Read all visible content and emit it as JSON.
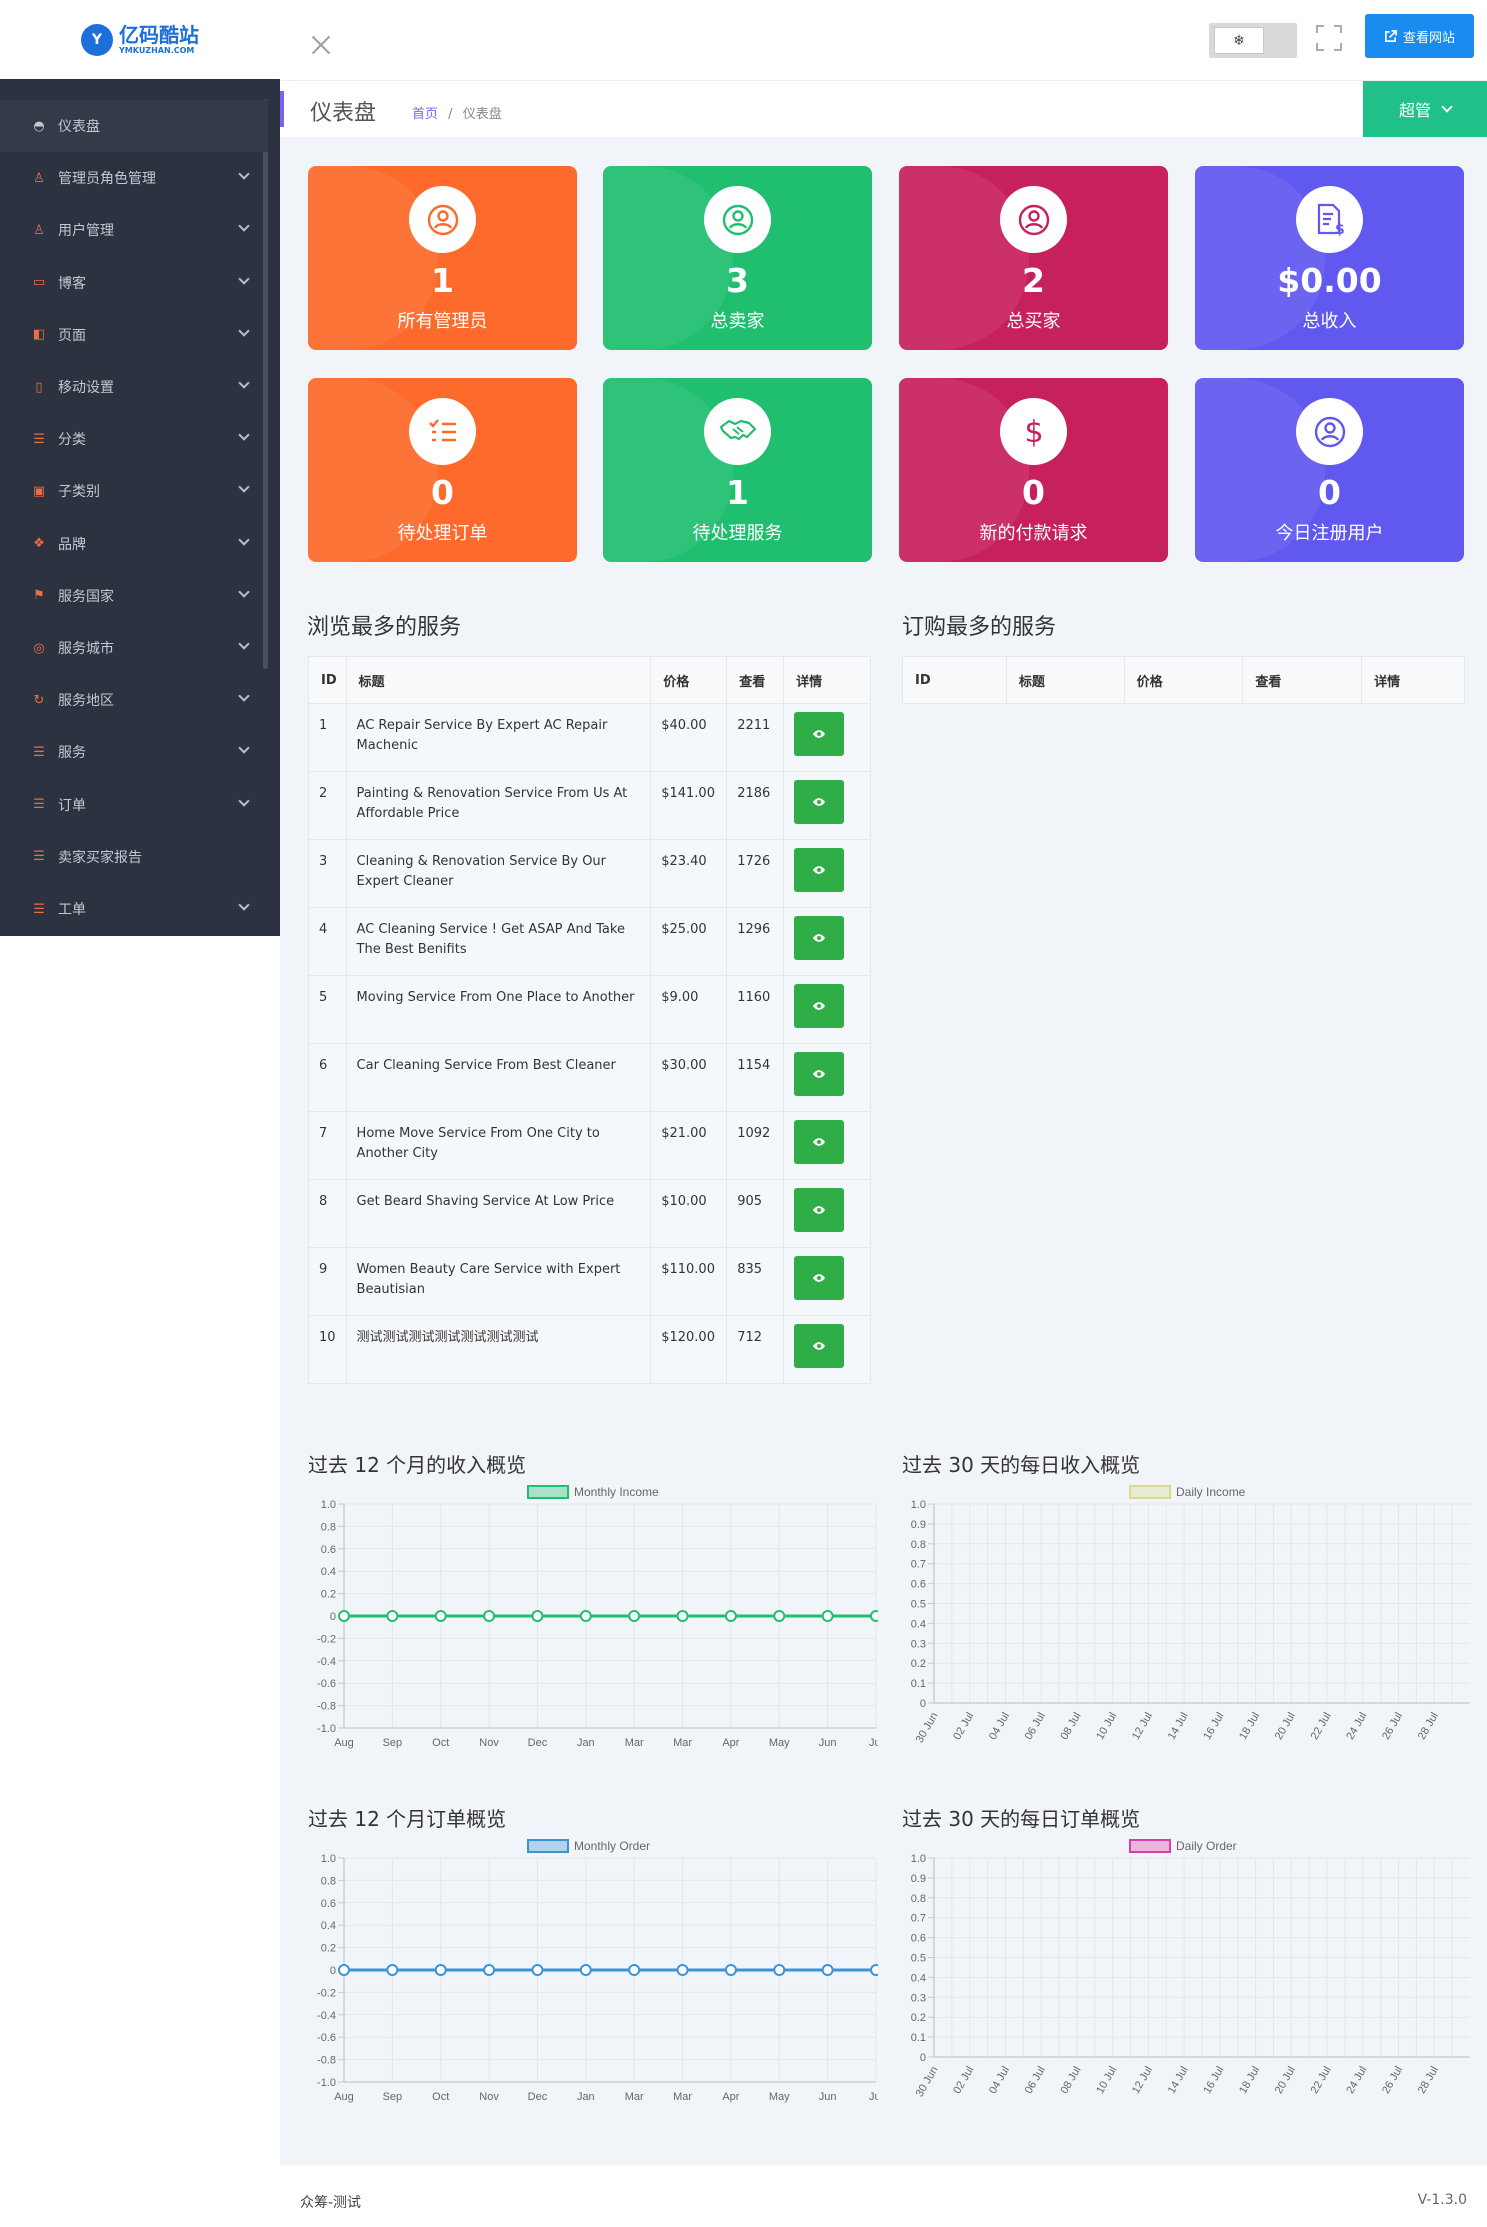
{
  "brand": {
    "logo_cn": "亿码酷站",
    "logo_en": "YMKUZHAN.COM"
  },
  "topbar": {
    "view_site_label": "查看网站",
    "theme_icon": "❄"
  },
  "breadcrumb": {
    "title": "仪表盘",
    "home": "首页",
    "sep": "/",
    "current": "仪表盘",
    "role": "超管"
  },
  "sidebar": {
    "items": [
      {
        "label": "仪表盘",
        "icon": "dashboard-icon",
        "active": true,
        "chevron": false
      },
      {
        "label": "管理员角色管理",
        "icon": "user-icon",
        "chevron": true
      },
      {
        "label": "用户管理",
        "icon": "user-icon",
        "chevron": true
      },
      {
        "label": "博客",
        "icon": "chat-icon",
        "chevron": true
      },
      {
        "label": "页面",
        "icon": "pages-icon",
        "chevron": true
      },
      {
        "label": "移动设置",
        "icon": "mobile-icon",
        "chevron": true
      },
      {
        "label": "分类",
        "icon": "list-icon",
        "chevron": true
      },
      {
        "label": "子类别",
        "icon": "card-icon",
        "chevron": true
      },
      {
        "label": "品牌",
        "icon": "layers-icon",
        "chevron": true
      },
      {
        "label": "服务国家",
        "icon": "flag-icon",
        "chevron": true
      },
      {
        "label": "服务城市",
        "icon": "compass-icon",
        "chevron": true
      },
      {
        "label": "服务地区",
        "icon": "arrow-icon",
        "chevron": true
      },
      {
        "label": "服务",
        "icon": "list-icon",
        "chevron": true
      },
      {
        "label": "订单",
        "icon": "list-icon",
        "chevron": true
      },
      {
        "label": "卖家买家报告",
        "icon": "list-icon",
        "chevron": false
      },
      {
        "label": "工单",
        "icon": "list-icon",
        "chevron": true
      }
    ]
  },
  "cards": [
    {
      "value": "1",
      "label": "所有管理员",
      "color": "#fd6a2b",
      "icon": "user-circle-icon"
    },
    {
      "value": "3",
      "label": "总卖家",
      "color": "#20bf70",
      "icon": "user-circle-icon"
    },
    {
      "value": "2",
      "label": "总买家",
      "color": "#c7215d",
      "icon": "user-circle-icon"
    },
    {
      "value": "$0.00",
      "label": "总收入",
      "color": "#6158f0",
      "icon": "invoice-icon"
    },
    {
      "value": "0",
      "label": "待处理订单",
      "color": "#fd6a2b",
      "icon": "checklist-icon"
    },
    {
      "value": "1",
      "label": "待处理服务",
      "color": "#20bf70",
      "icon": "handshake-icon"
    },
    {
      "value": "0",
      "label": "新的付款请求",
      "color": "#c7215d",
      "icon": "dollar-icon"
    },
    {
      "value": "0",
      "label": "今日注册用户",
      "color": "#6158f0",
      "icon": "user-circle-icon"
    }
  ],
  "most_viewed": {
    "title": "浏览最多的服务",
    "headers": [
      "ID",
      "标题",
      "价格",
      "查看",
      "详情"
    ],
    "rows": [
      {
        "id": "1",
        "title": "AC Repair Service By Expert AC Repair Machenic",
        "price": "$40.00",
        "views": "2211"
      },
      {
        "id": "2",
        "title": "Painting & Renovation Service From Us At Affordable Price",
        "price": "$141.00",
        "views": "2186"
      },
      {
        "id": "3",
        "title": "Cleaning & Renovation Service By Our Expert Cleaner",
        "price": "$23.40",
        "views": "1726"
      },
      {
        "id": "4",
        "title": "AC Cleaning Service ! Get ASAP And Take The Best Benifits",
        "price": "$25.00",
        "views": "1296"
      },
      {
        "id": "5",
        "title": "Moving Service From One Place to Another",
        "price": "$9.00",
        "views": "1160"
      },
      {
        "id": "6",
        "title": "Car Cleaning Service From Best Cleaner",
        "price": "$30.00",
        "views": "1154"
      },
      {
        "id": "7",
        "title": "Home Move Service From One City to Another City",
        "price": "$21.00",
        "views": "1092"
      },
      {
        "id": "8",
        "title": "Get Beard Shaving Service At Low Price",
        "price": "$10.00",
        "views": "905"
      },
      {
        "id": "9",
        "title": "Women Beauty Care Service with Expert Beautisian",
        "price": "$110.00",
        "views": "835"
      },
      {
        "id": "10",
        "title": "测试测试测试测试测试测试测试",
        "price": "$120.00",
        "views": "712"
      }
    ]
  },
  "most_ordered": {
    "title": "订购最多的服务",
    "headers": [
      "ID",
      "标题",
      "价格",
      "查看",
      "详情"
    ]
  },
  "chart_data": [
    {
      "type": "line",
      "title": "过去 12 个月的收入概览",
      "legend": "Monthly Income",
      "color": "#20bf70",
      "categories": [
        "Aug",
        "Sep",
        "Oct",
        "Nov",
        "Dec",
        "Jan",
        "Mar",
        "Mar",
        "Apr",
        "May",
        "Jun",
        "Jul"
      ],
      "values": [
        0,
        0,
        0,
        0,
        0,
        0,
        0,
        0,
        0,
        0,
        0,
        0
      ],
      "ylim": [
        -1.0,
        1.0
      ],
      "yticks": [
        "1.0",
        "0.8",
        "0.6",
        "0.4",
        "0.2",
        "0",
        "-0.2",
        "-0.4",
        "-0.6",
        "-0.8",
        "-1.0"
      ],
      "grid": true,
      "legend_position": "top"
    },
    {
      "type": "line",
      "title": "过去 30 天的每日收入概览",
      "legend": "Daily Income",
      "color": "#d9dc8c",
      "categories": [
        "30 Jun",
        "02 Jul",
        "04 Jul",
        "06 Jul",
        "08 Jul",
        "10 Jul",
        "12 Jul",
        "14 Jul",
        "16 Jul",
        "18 Jul",
        "20 Jul",
        "22 Jul",
        "24 Jul",
        "26 Jul",
        "28 Jul"
      ],
      "values": [],
      "ylim": [
        0,
        1.0
      ],
      "yticks": [
        "1.0",
        "0.9",
        "0.8",
        "0.7",
        "0.6",
        "0.5",
        "0.4",
        "0.3",
        "0.2",
        "0.1",
        "0"
      ],
      "grid": true,
      "legend_position": "top"
    },
    {
      "type": "line",
      "title": "过去 12 个月订单概览",
      "legend": "Monthly Order",
      "color": "#3b94d6",
      "categories": [
        "Aug",
        "Sep",
        "Oct",
        "Nov",
        "Dec",
        "Jan",
        "Mar",
        "Mar",
        "Apr",
        "May",
        "Jun",
        "Jul"
      ],
      "values": [
        0,
        0,
        0,
        0,
        0,
        0,
        0,
        0,
        0,
        0,
        0,
        0
      ],
      "ylim": [
        -1.0,
        1.0
      ],
      "yticks": [
        "1.0",
        "0.8",
        "0.6",
        "0.4",
        "0.2",
        "0",
        "-0.2",
        "-0.4",
        "-0.6",
        "-0.8",
        "-1.0"
      ],
      "grid": true,
      "legend_position": "top"
    },
    {
      "type": "line",
      "title": "过去 30 天的每日订单概览",
      "legend": "Daily Order",
      "color": "#d83fa8",
      "categories": [
        "30 Jun",
        "02 Jul",
        "04 Jul",
        "06 Jul",
        "08 Jul",
        "10 Jul",
        "12 Jul",
        "14 Jul",
        "16 Jul",
        "18 Jul",
        "20 Jul",
        "22 Jul",
        "24 Jul",
        "26 Jul",
        "28 Jul"
      ],
      "values": [],
      "ylim": [
        0,
        1.0
      ],
      "yticks": [
        "1.0",
        "0.9",
        "0.8",
        "0.7",
        "0.6",
        "0.5",
        "0.4",
        "0.3",
        "0.2",
        "0.1",
        "0"
      ],
      "grid": true,
      "legend_position": "top"
    }
  ],
  "footer": {
    "left": "众筹-测试",
    "version": "V-1.3.0"
  }
}
